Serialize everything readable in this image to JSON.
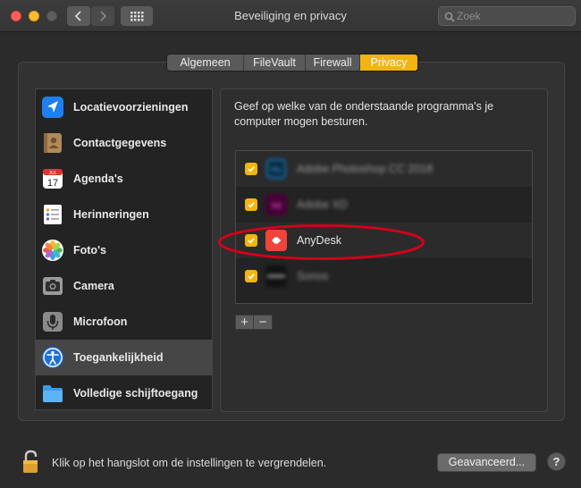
{
  "window": {
    "title": "Beveiliging en privacy",
    "search_placeholder": "Zoek"
  },
  "tabs": [
    {
      "label": "Algemeen",
      "active": false
    },
    {
      "label": "FileVault",
      "active": false
    },
    {
      "label": "Firewall",
      "active": false
    },
    {
      "label": "Privacy",
      "active": true
    }
  ],
  "sidebar": {
    "items": [
      {
        "label": "Locatievoorzieningen",
        "icon": "location-arrow-icon"
      },
      {
        "label": "Contactgegevens",
        "icon": "contacts-book-icon"
      },
      {
        "label": "Agenda's",
        "icon": "calendar-icon"
      },
      {
        "label": "Herinneringen",
        "icon": "reminders-icon"
      },
      {
        "label": "Foto's",
        "icon": "photos-icon"
      },
      {
        "label": "Camera",
        "icon": "camera-icon"
      },
      {
        "label": "Microfoon",
        "icon": "microphone-icon"
      },
      {
        "label": "Toegankelijkheid",
        "icon": "accessibility-icon",
        "selected": true
      },
      {
        "label": "Volledige schijftoegang",
        "icon": "folder-icon"
      }
    ],
    "calendar_month": "JUL",
    "calendar_day": "17"
  },
  "main": {
    "description": "Geef op welke van de onderstaande programma's je computer mogen besturen.",
    "apps": [
      {
        "label": "Adobe Photoshop CC 2018",
        "checked": true,
        "blurred": true,
        "icon": "photoshop-icon"
      },
      {
        "label": "Adobe XD",
        "checked": true,
        "blurred": true,
        "icon": "adobe-xd-icon"
      },
      {
        "label": "AnyDesk",
        "checked": true,
        "blurred": false,
        "icon": "anydesk-icon"
      },
      {
        "label": "Sonos",
        "checked": true,
        "blurred": true,
        "icon": "sonos-icon"
      }
    ],
    "add_label": "+",
    "remove_label": "−",
    "highlight_color": "#d0021b"
  },
  "footer": {
    "lock_text": "Klik op het hangslot om de instellingen te vergrendelen.",
    "advanced_label": "Geavanceerd...",
    "help_label": "?"
  },
  "colors": {
    "accent": "#f2b510",
    "window_bg": "#2b2b2b"
  }
}
